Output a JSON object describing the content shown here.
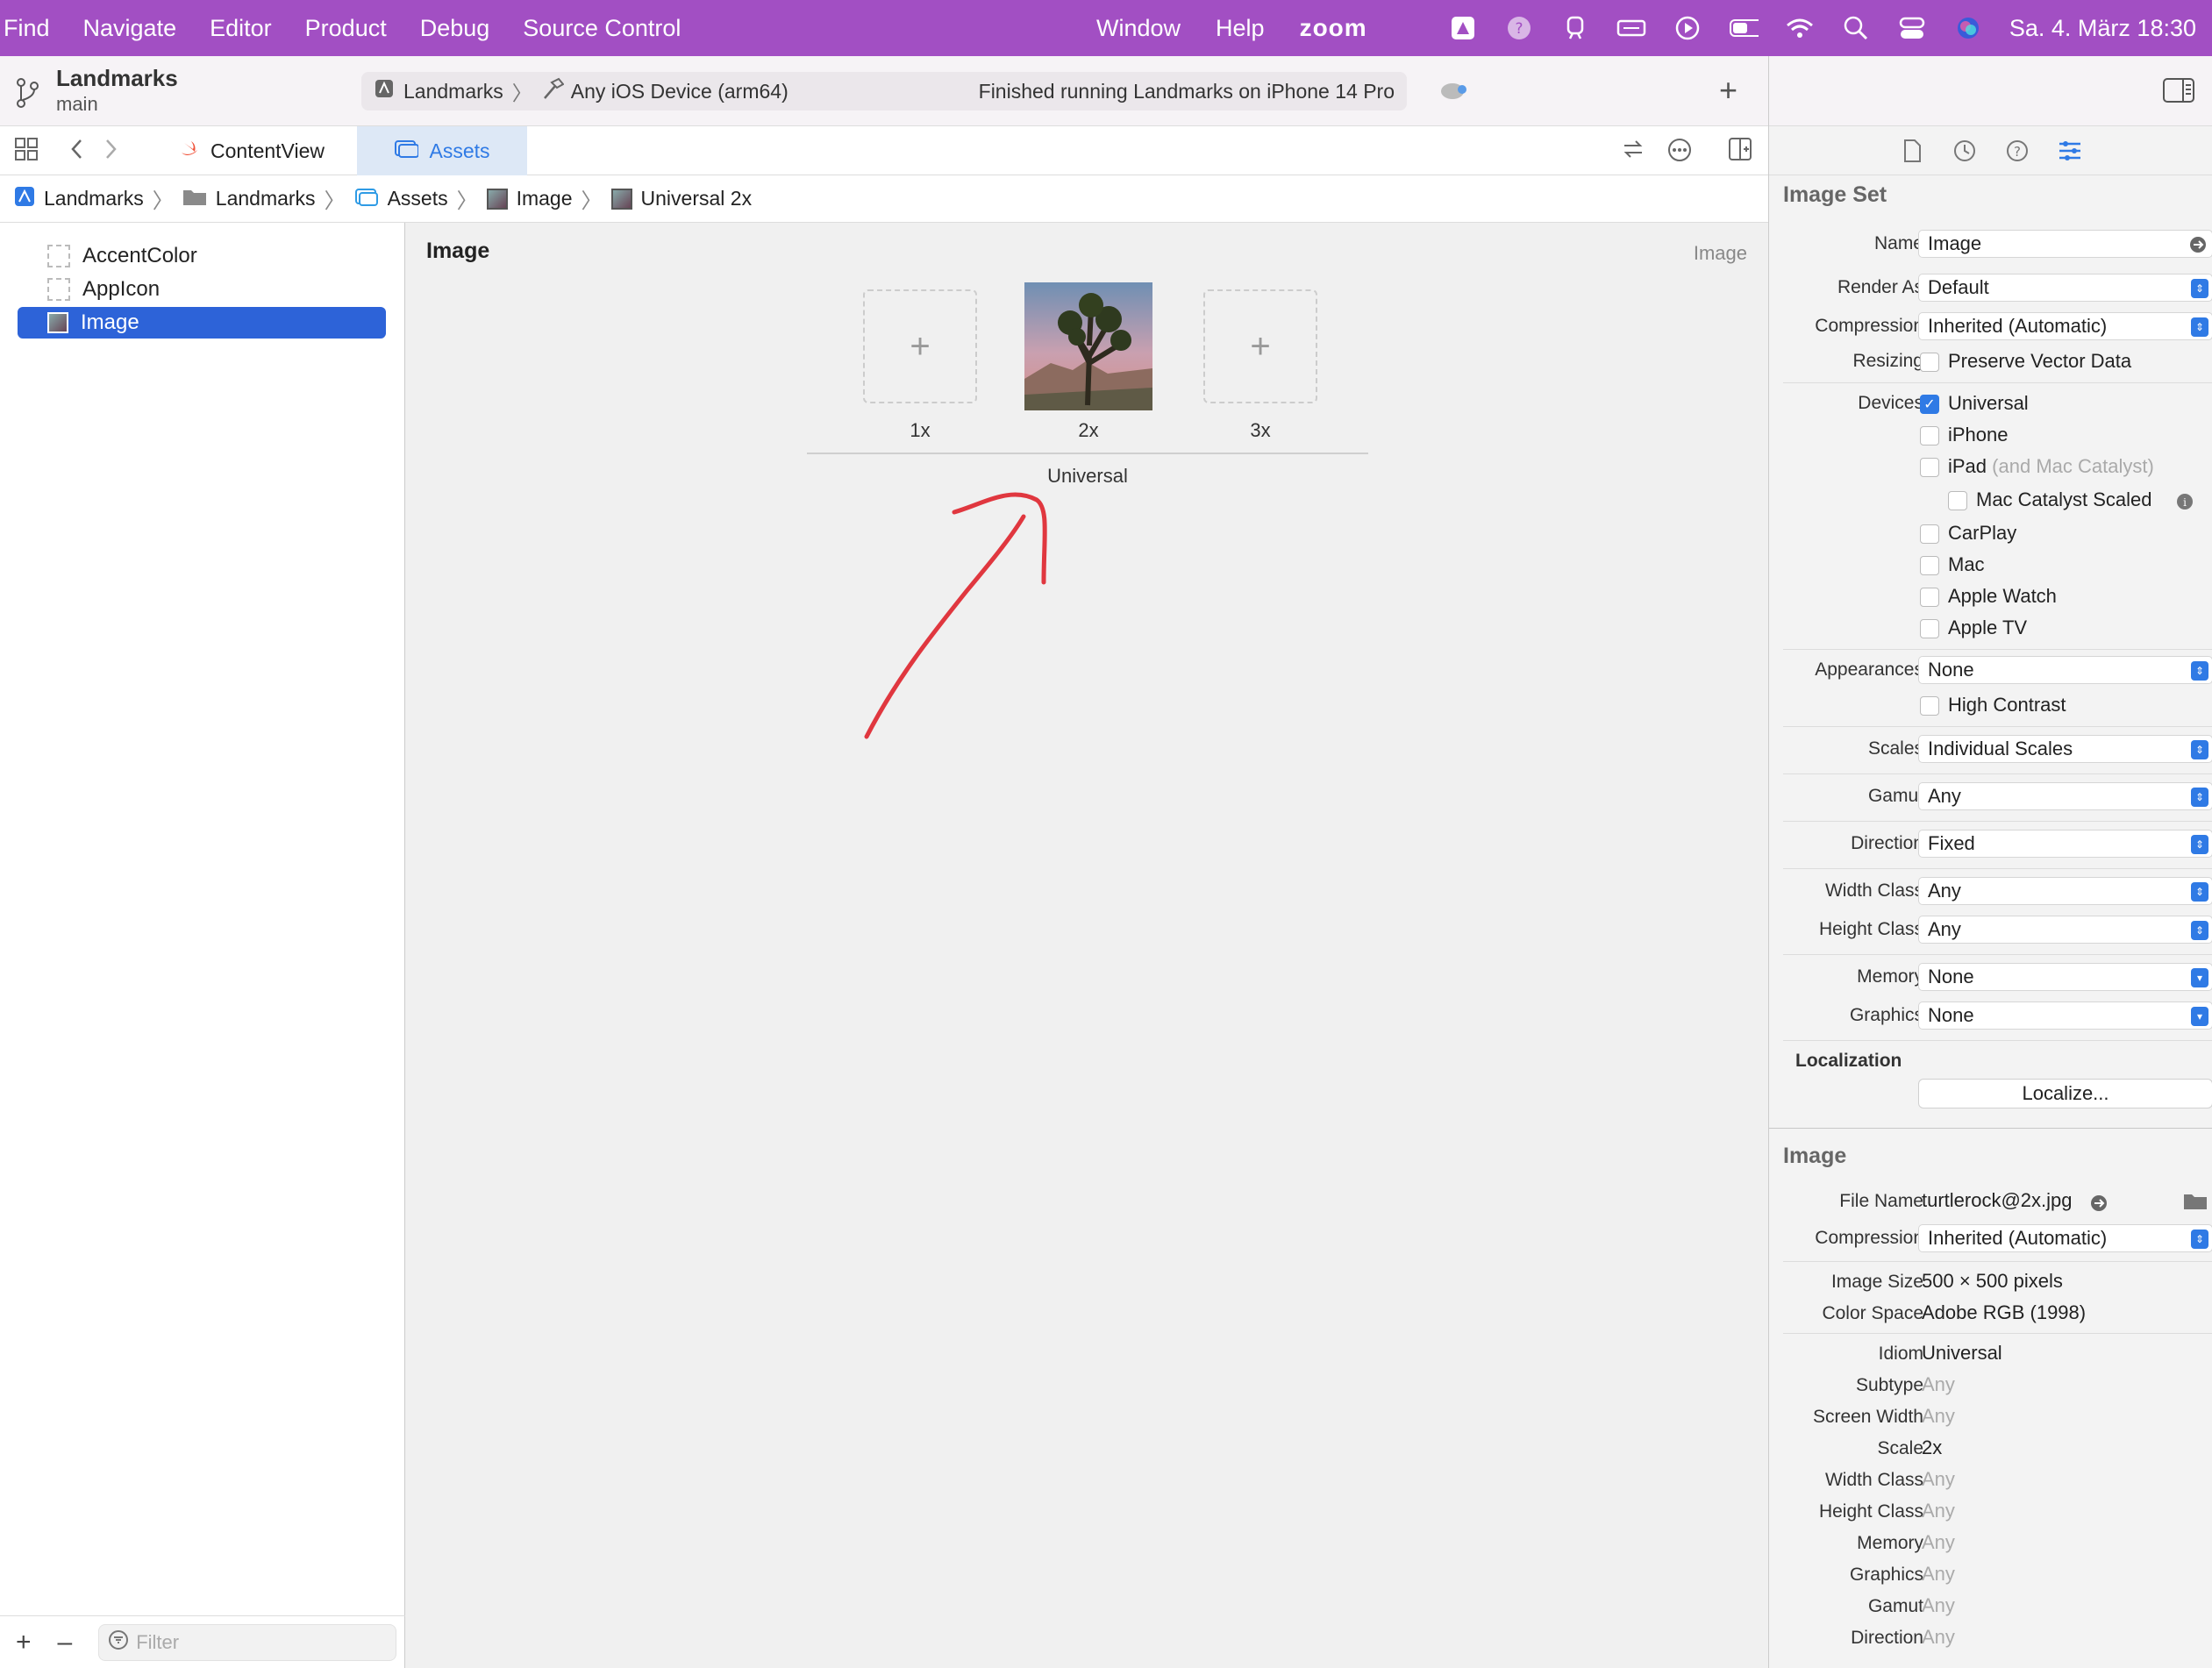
{
  "menubar": {
    "left": [
      "Find",
      "Navigate",
      "Editor",
      "Product",
      "Debug",
      "Source Control"
    ],
    "middle": [
      "Window",
      "Help"
    ],
    "zoom": "zoom",
    "datetime": "Sa. 4. März  18:30"
  },
  "toolbar": {
    "project_name": "Landmarks",
    "branch": "main",
    "scheme": "Landmarks",
    "destination": "Any iOS Device (arm64)",
    "status": "Finished running Landmarks on iPhone 14 Pro"
  },
  "tabs": {
    "content_view": "ContentView",
    "assets": "Assets"
  },
  "breadcrumb": [
    "Landmarks",
    "Landmarks",
    "Assets",
    "Image",
    "Universal 2x"
  ],
  "navigator": {
    "items": [
      "AccentColor",
      "AppIcon",
      "Image"
    ],
    "filter_placeholder": "Filter"
  },
  "editor": {
    "title": "Image",
    "subtitle": "Image",
    "slots": [
      "1x",
      "2x",
      "3x"
    ],
    "group_label": "Universal"
  },
  "inspector": {
    "image_set_title": "Image Set",
    "name_label": "Name",
    "name_value": "Image",
    "render_as_label": "Render As",
    "render_as_value": "Default",
    "compression_label": "Compression",
    "compression_value": "Inherited (Automatic)",
    "resizing_label": "Resizing",
    "resizing_option": "Preserve Vector Data",
    "devices_label": "Devices",
    "devices": {
      "universal": "Universal",
      "iphone": "iPhone",
      "ipad": "iPad",
      "ipad_sub": "(and Mac Catalyst)",
      "mac_catalyst_scaled": "Mac Catalyst Scaled",
      "carplay": "CarPlay",
      "mac": "Mac",
      "apple_watch": "Apple Watch",
      "apple_tv": "Apple TV"
    },
    "appearances_label": "Appearances",
    "appearances_value": "None",
    "high_contrast": "High Contrast",
    "scales_label": "Scales",
    "scales_value": "Individual Scales",
    "gamut_label": "Gamut",
    "gamut_value": "Any",
    "direction_label": "Direction",
    "direction_value": "Fixed",
    "width_class_label": "Width Class",
    "width_class_value": "Any",
    "height_class_label": "Height Class",
    "height_class_value": "Any",
    "memory_label": "Memory",
    "memory_value": "None",
    "graphics_label": "Graphics",
    "graphics_value": "None",
    "localization_title": "Localization",
    "localize_button": "Localize...",
    "image_title": "Image",
    "file_name_label": "File Name",
    "file_name_value": "turtlerock@2x.jpg",
    "img_compression_label": "Compression",
    "img_compression_value": "Inherited (Automatic)",
    "image_size_label": "Image Size",
    "image_size_value": "500 × 500 pixels",
    "color_space_label": "Color Space",
    "color_space_value": "Adobe RGB (1998)",
    "idiom_label": "Idiom",
    "idiom_value": "Universal",
    "subtype_label": "Subtype",
    "subtype_value": "Any",
    "screen_width_label": "Screen Width",
    "screen_width_value": "Any",
    "scale_label": "Scale",
    "scale_value": "2x",
    "d_width_class_label": "Width Class",
    "d_width_class_value": "Any",
    "d_height_class_label": "Height Class",
    "d_height_class_value": "Any",
    "d_memory_label": "Memory",
    "d_memory_value": "Any",
    "d_graphics_label": "Graphics",
    "d_graphics_value": "Any",
    "d_gamut_label": "Gamut",
    "d_gamut_value": "Any",
    "d_direction_label": "Direction",
    "d_direction_value": "Any"
  },
  "colors": {
    "menubar": "#a24fc3",
    "accent": "#2f7ae5",
    "selection": "#2d63d8",
    "annotation": "#e0373f"
  }
}
